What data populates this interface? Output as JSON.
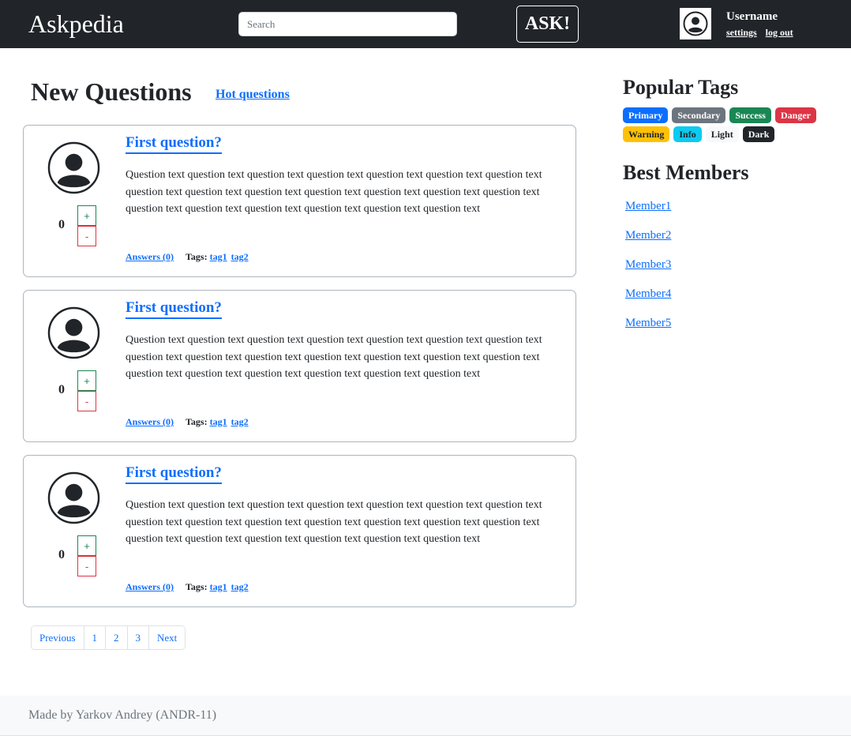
{
  "header": {
    "brand": "Askpedia",
    "search_placeholder": "Search",
    "ask_label": "ASK!",
    "username": "Username",
    "settings_label": "settings",
    "logout_label": "log out"
  },
  "main": {
    "title": "New Questions",
    "hot_link": "Hot questions",
    "questions": [
      {
        "title": "First question?",
        "text": "Question text question text question text question text question text question text question text question text question text question text question text question text question text question text question text question text question text question text question text question text",
        "rating": "0",
        "vote_up": "+",
        "vote_down": "-",
        "answers": "Answers (0)",
        "tags_label": "Tags:",
        "tags": [
          "tag1",
          "tag2"
        ]
      },
      {
        "title": "First question?",
        "text": "Question text question text question text question text question text question text question text question text question text question text question text question text question text question text question text question text question text question text question text question text",
        "rating": "0",
        "vote_up": "+",
        "vote_down": "-",
        "answers": "Answers (0)",
        "tags_label": "Tags:",
        "tags": [
          "tag1",
          "tag2"
        ]
      },
      {
        "title": "First question?",
        "text": "Question text question text question text question text question text question text question text question text question text question text question text question text question text question text question text question text question text question text question text question text",
        "rating": "0",
        "vote_up": "+",
        "vote_down": "-",
        "answers": "Answers (0)",
        "tags_label": "Tags:",
        "tags": [
          "tag1",
          "tag2"
        ]
      }
    ],
    "pagination": [
      "Previous",
      "1",
      "2",
      "3",
      "Next"
    ]
  },
  "sidebar": {
    "tags_title": "Popular Tags",
    "tags": [
      {
        "label": "Primary",
        "bg": "#0d6efd",
        "fg": "#ffffff"
      },
      {
        "label": "Secondary",
        "bg": "#6c757d",
        "fg": "#ffffff"
      },
      {
        "label": "Success",
        "bg": "#198754",
        "fg": "#ffffff"
      },
      {
        "label": "Danger",
        "bg": "#dc3545",
        "fg": "#ffffff"
      },
      {
        "label": "Warning",
        "bg": "#ffc107",
        "fg": "#212529"
      },
      {
        "label": "Info",
        "bg": "#0dcaf0",
        "fg": "#212529"
      },
      {
        "label": "Light",
        "bg": "#f8f9fa",
        "fg": "#212529"
      },
      {
        "label": "Dark",
        "bg": "#212529",
        "fg": "#ffffff"
      }
    ],
    "members_title": "Best Members",
    "members": [
      "Member1",
      "Member2",
      "Member3",
      "Member4",
      "Member5"
    ]
  },
  "footer": {
    "text": "Made by Yarkov Andrey (ANDR-11)"
  },
  "colors": {
    "navbar_bg": "#212529",
    "link": "#0d6efd",
    "vote_up": "#198754",
    "vote_down": "#dc3545"
  }
}
